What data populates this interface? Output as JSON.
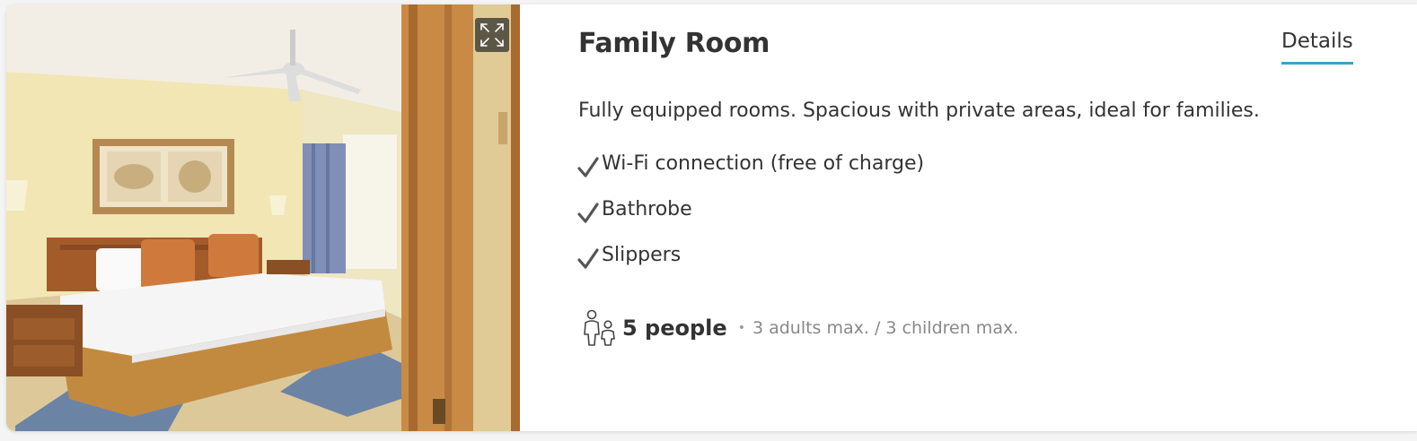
{
  "room": {
    "title": "Family Room",
    "details_tab": "Details",
    "description": "Fully equipped rooms. Spacious with private areas, ideal for families.",
    "amenities": [
      {
        "label": "Wi-Fi connection (free of charge)",
        "icon": "checkmark-icon"
      },
      {
        "label": "Bathrobe",
        "icon": "checkmark-icon"
      },
      {
        "label": "Slippers",
        "icon": "checkmark-icon"
      }
    ],
    "capacity": {
      "icon": "people-icon",
      "count": "5 people",
      "separator": "•",
      "limits": "3 adults max. /  3 children max."
    },
    "photo": {
      "icon": "expand-icon"
    }
  },
  "colors": {
    "accent": "#3aa3c8",
    "text": "#333333",
    "muted": "#888888"
  }
}
